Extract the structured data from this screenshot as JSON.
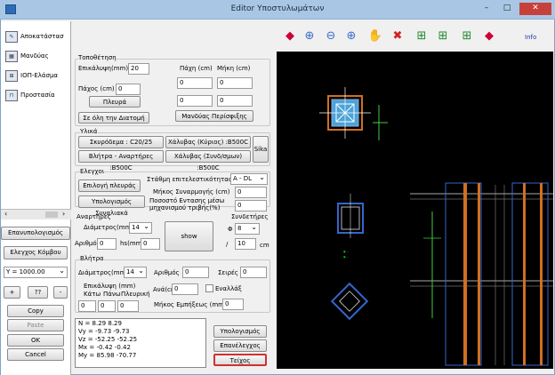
{
  "window": {
    "title": "Editor Υποστυλωμάτων",
    "info": "Info"
  },
  "sidebar": {
    "items": [
      {
        "label": "Αποκατάστασ"
      },
      {
        "label": "Μανδύας"
      },
      {
        "label": "ΙΟΠ-Ελάσμα"
      },
      {
        "label": "Προστασία"
      }
    ]
  },
  "left_buttons": {
    "recalc": "Επανυπολογισμός",
    "check_node": "Ελεγχος Κόμβου",
    "y_value": "Y = 1000.00",
    "plus": "+",
    "qq": "??",
    "minus": "-",
    "copy": "Copy",
    "paste": "Paste",
    "ok": "OK",
    "cancel": "Cancel"
  },
  "placement": {
    "title": "Τοποθέτηση",
    "cover_label": "Επικάλυψη(mm)",
    "cover_value": "20",
    "thick_label": "Πάχος (cm)",
    "thick_value": "0",
    "side_btn": "Πλευρά",
    "all_btn": "Σε όλη την Διατομή",
    "col_paxi": "Πάχη (cm)",
    "col_mikh": "Μήκη (cm)",
    "r1a": "0",
    "r1b": "0",
    "r2a": "0",
    "r2b": "0",
    "perimeter_btn": "Μανδύας Περίσφιξης"
  },
  "materials": {
    "title": "Υλικά",
    "concrete": "Σκυρόδεμα : C20/25",
    "steel_main": "Χάλυβας (Κύριος) :B500C",
    "anchors": "Βλήτρα - Αναρτήρες :B500C",
    "steel_link": "Χάλυβας (Συνδ/σμων) :B500C",
    "sika": "Sika"
  },
  "checks": {
    "title": "Ελεγχοι",
    "side_choice": "Επιλογή πλευράς",
    "calc_shear": "Υπολογισμός Συναλιακά",
    "trust_label": "Στάθμη επιτελεστικότητας",
    "trust_value": "A - DL",
    "anchor_len_label": "Μήκος Συναρμογής (cm)",
    "anchor_len_value": "0",
    "ratio_label": "Ποσοστό Εντασης μέσω μηχανισμού τριβής(%)",
    "ratio_value": "0"
  },
  "hangers": {
    "title": "Αναρτήρες",
    "diam_label": "Διάμετρος(mm)",
    "diam_value": "14",
    "count_label": "Αριθμός",
    "count_value": "0",
    "hs_label": "hs(mm)",
    "hs_value": "0",
    "show_btn": "show",
    "links_title": "Συνδετήρες",
    "phi": "Φ",
    "links_diam": "8",
    "slash": "/",
    "links_spacing": "10",
    "cm": "cm"
  },
  "dowels": {
    "title": "Βλήτρα",
    "diam_label": "Διάμετρος(mm)",
    "diam_value": "14",
    "count_label": "Αριθμός",
    "count_value": "0",
    "rows_label": "Σειρές",
    "rows_value": "0",
    "cover_label": "Επικάλυψη (mm)",
    "k_label": "Κάτω",
    "top_label": "Πάνω",
    "side_label": "Πλευρική",
    "k_value": "0",
    "top_value": "0",
    "side_value": "0",
    "per_label": "Ανά(cm)",
    "per_value": "0",
    "alt_label": "Εναλλάξ",
    "embed_label": "Μήκος Εμπήξεως (mm)",
    "embed_value": "0"
  },
  "results": {
    "lines": [
      "N = 8.29 8.29",
      "Vy = -9.73 -9.73",
      "Vz = -52.25 -52.25",
      "Mx = -0.42 -0.42",
      "My = 85.98 -70.77"
    ]
  },
  "actions": {
    "calc": "Υπολογισμός",
    "recheck": "Επανέλεγχος",
    "wall": "Τείχος"
  },
  "colors": {
    "accent": "#2e6cb5",
    "canvas": "#000000",
    "close": "#c7413c"
  }
}
